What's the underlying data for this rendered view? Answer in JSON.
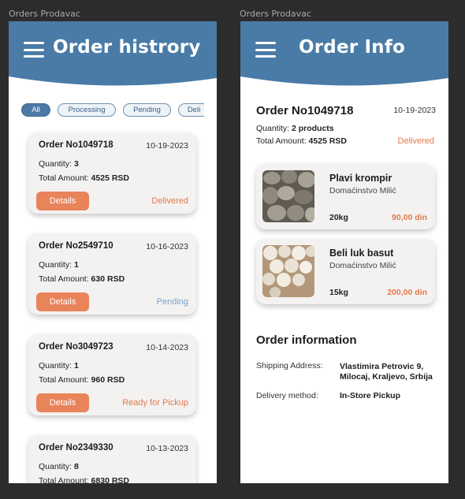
{
  "frames": {
    "left_label": "Orders Prodavac",
    "right_label": "Orders Prodavac"
  },
  "colors": {
    "header": "#4a7ba7",
    "accent": "#e9835a",
    "pending": "#7aa1c9"
  },
  "history": {
    "title": "Order histrory",
    "filters": [
      "All",
      "Processing",
      "Pending",
      "Deli"
    ],
    "orders": [
      {
        "number": "Order No1049718",
        "date": "10-19-2023",
        "quantity_label": "Quantity:",
        "quantity": "3",
        "total_label": "Total Amount:",
        "total": "4525 RSD",
        "details": "Details",
        "status": "Delivered"
      },
      {
        "number": "Order No2549710",
        "date": "10-16-2023",
        "quantity_label": "Quantity:",
        "quantity": "1",
        "total_label": "Total Amount:",
        "total": "630 RSD",
        "details": "Details",
        "status": "Pending"
      },
      {
        "number": "Order No3049723",
        "date": "10-14-2023",
        "quantity_label": "Quantity:",
        "quantity": "1",
        "total_label": "Total Amount:",
        "total": "960 RSD",
        "details": "Details",
        "status": "Ready for Pickup"
      },
      {
        "number": "Order No2349330",
        "date": "10-13-2023",
        "quantity_label": "Quantity:",
        "quantity": "8",
        "total_label": "Total Amount:",
        "total": "6830 RSD"
      }
    ]
  },
  "info": {
    "title": "Order Info",
    "order_number": "Order No1049718",
    "date": "10-19-2023",
    "quantity_label": "Quantity:",
    "quantity": "2 products",
    "total_label": "Total Amount:",
    "total": "4525 RSD",
    "status": "Delivered",
    "products": [
      {
        "name": "Plavi krompir",
        "farm": "Domaćinstvo Milić",
        "qty": "20kg",
        "price": "90,00 din",
        "image": "potatoes"
      },
      {
        "name": "Beli luk basut",
        "farm": "Domaćinstvo Milić",
        "qty": "15kg",
        "price": "200,00 din",
        "image": "garlic"
      }
    ],
    "section_title": "Order information",
    "shipping_label": "Shipping Address:",
    "shipping_line1": "Vlastimira Petrovic 9,",
    "shipping_line2": "Milocaj, Kraljevo, Srbija",
    "delivery_label": "Delivery method:",
    "delivery_value": "In-Store Pickup"
  }
}
